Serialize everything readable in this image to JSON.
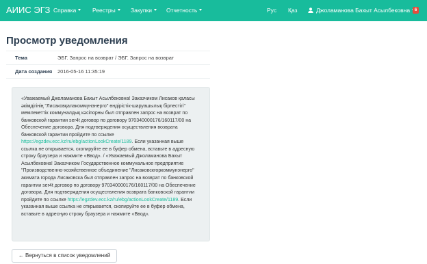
{
  "navbar": {
    "brand": "АИИС ЭГЗ",
    "menu": [
      "Справка",
      "Реестры",
      "Закупки",
      "Отчетность"
    ],
    "lang_ru": "Рус",
    "lang_kz": "Қаз",
    "user_name": "Джоламанова Бахыт Асылбековна",
    "notification_count": "6",
    "icons": {
      "user": "user-icon",
      "caret": "chevron-down-icon"
    }
  },
  "page": {
    "title": "Просмотр уведомления"
  },
  "details": {
    "topic_label": "Тема",
    "topic_value": "ЭБГ. Запрос на возврат / ЭБГ. Запрос на возврат",
    "created_label": "Дата создания",
    "created_value": "2016-05-16 11:35:19"
  },
  "message": {
    "p1": "«Уважаемый Джоламанова Бахыт Асылбековна! Заказчиком Лисаков қаласы әкімдігінің \"Лисаковқалакоммунэнерго\" өндірістік-шаруашылық бірлестігі\" мемлекеттік коммуналдық кәсіпорны был отправлен запрос на возврат по банковской гарантии ser4t договор по договору 970340000176/160117/00 на Обеспечение договора. Для подтверждения осуществления возврата банковской гарантии пройдите по ссылке",
    "link1": "https://egzdev.ecc.kz/ru/ebg/actionLookCreate/1189",
    "p2": ". Если указанная выше ссылка не открывается, скопируйте ее в буфер обмена, вставьте в адресную строку браузера и нажмите «Ввод». / «Уважаемый Джоламанова Бахыт Асылбековна! Заказчиком Государственное коммунальное предприятие \"Производственно-хозяйственное объединение \"Лисаковскгоркоммунэнерго\" акимата города Лисаковска был отправлен запрос на возврат по банковской гарантии ser4t договор по договору 970340000176/160117/00 на Обеспечение договора. Для подтверждения осуществления возврата банковской гарантии пройдите по ссылке",
    "link2": "https://egzdev.ecc.kz/ru/ebg/actionLookCreate/1189",
    "p3": ". Если указанная выше ссылка не открывается, скопируйте ее в буфер обмена, вставьте в адресную строку браузера и нажмите «Ввод»."
  },
  "actions": {
    "back_label": "← Вернуться в список уведомлений"
  },
  "colors": {
    "navbar": "#18bc9c",
    "badge": "#e74c3c",
    "link": "#18bc9c",
    "well": "#ecf0f1"
  }
}
